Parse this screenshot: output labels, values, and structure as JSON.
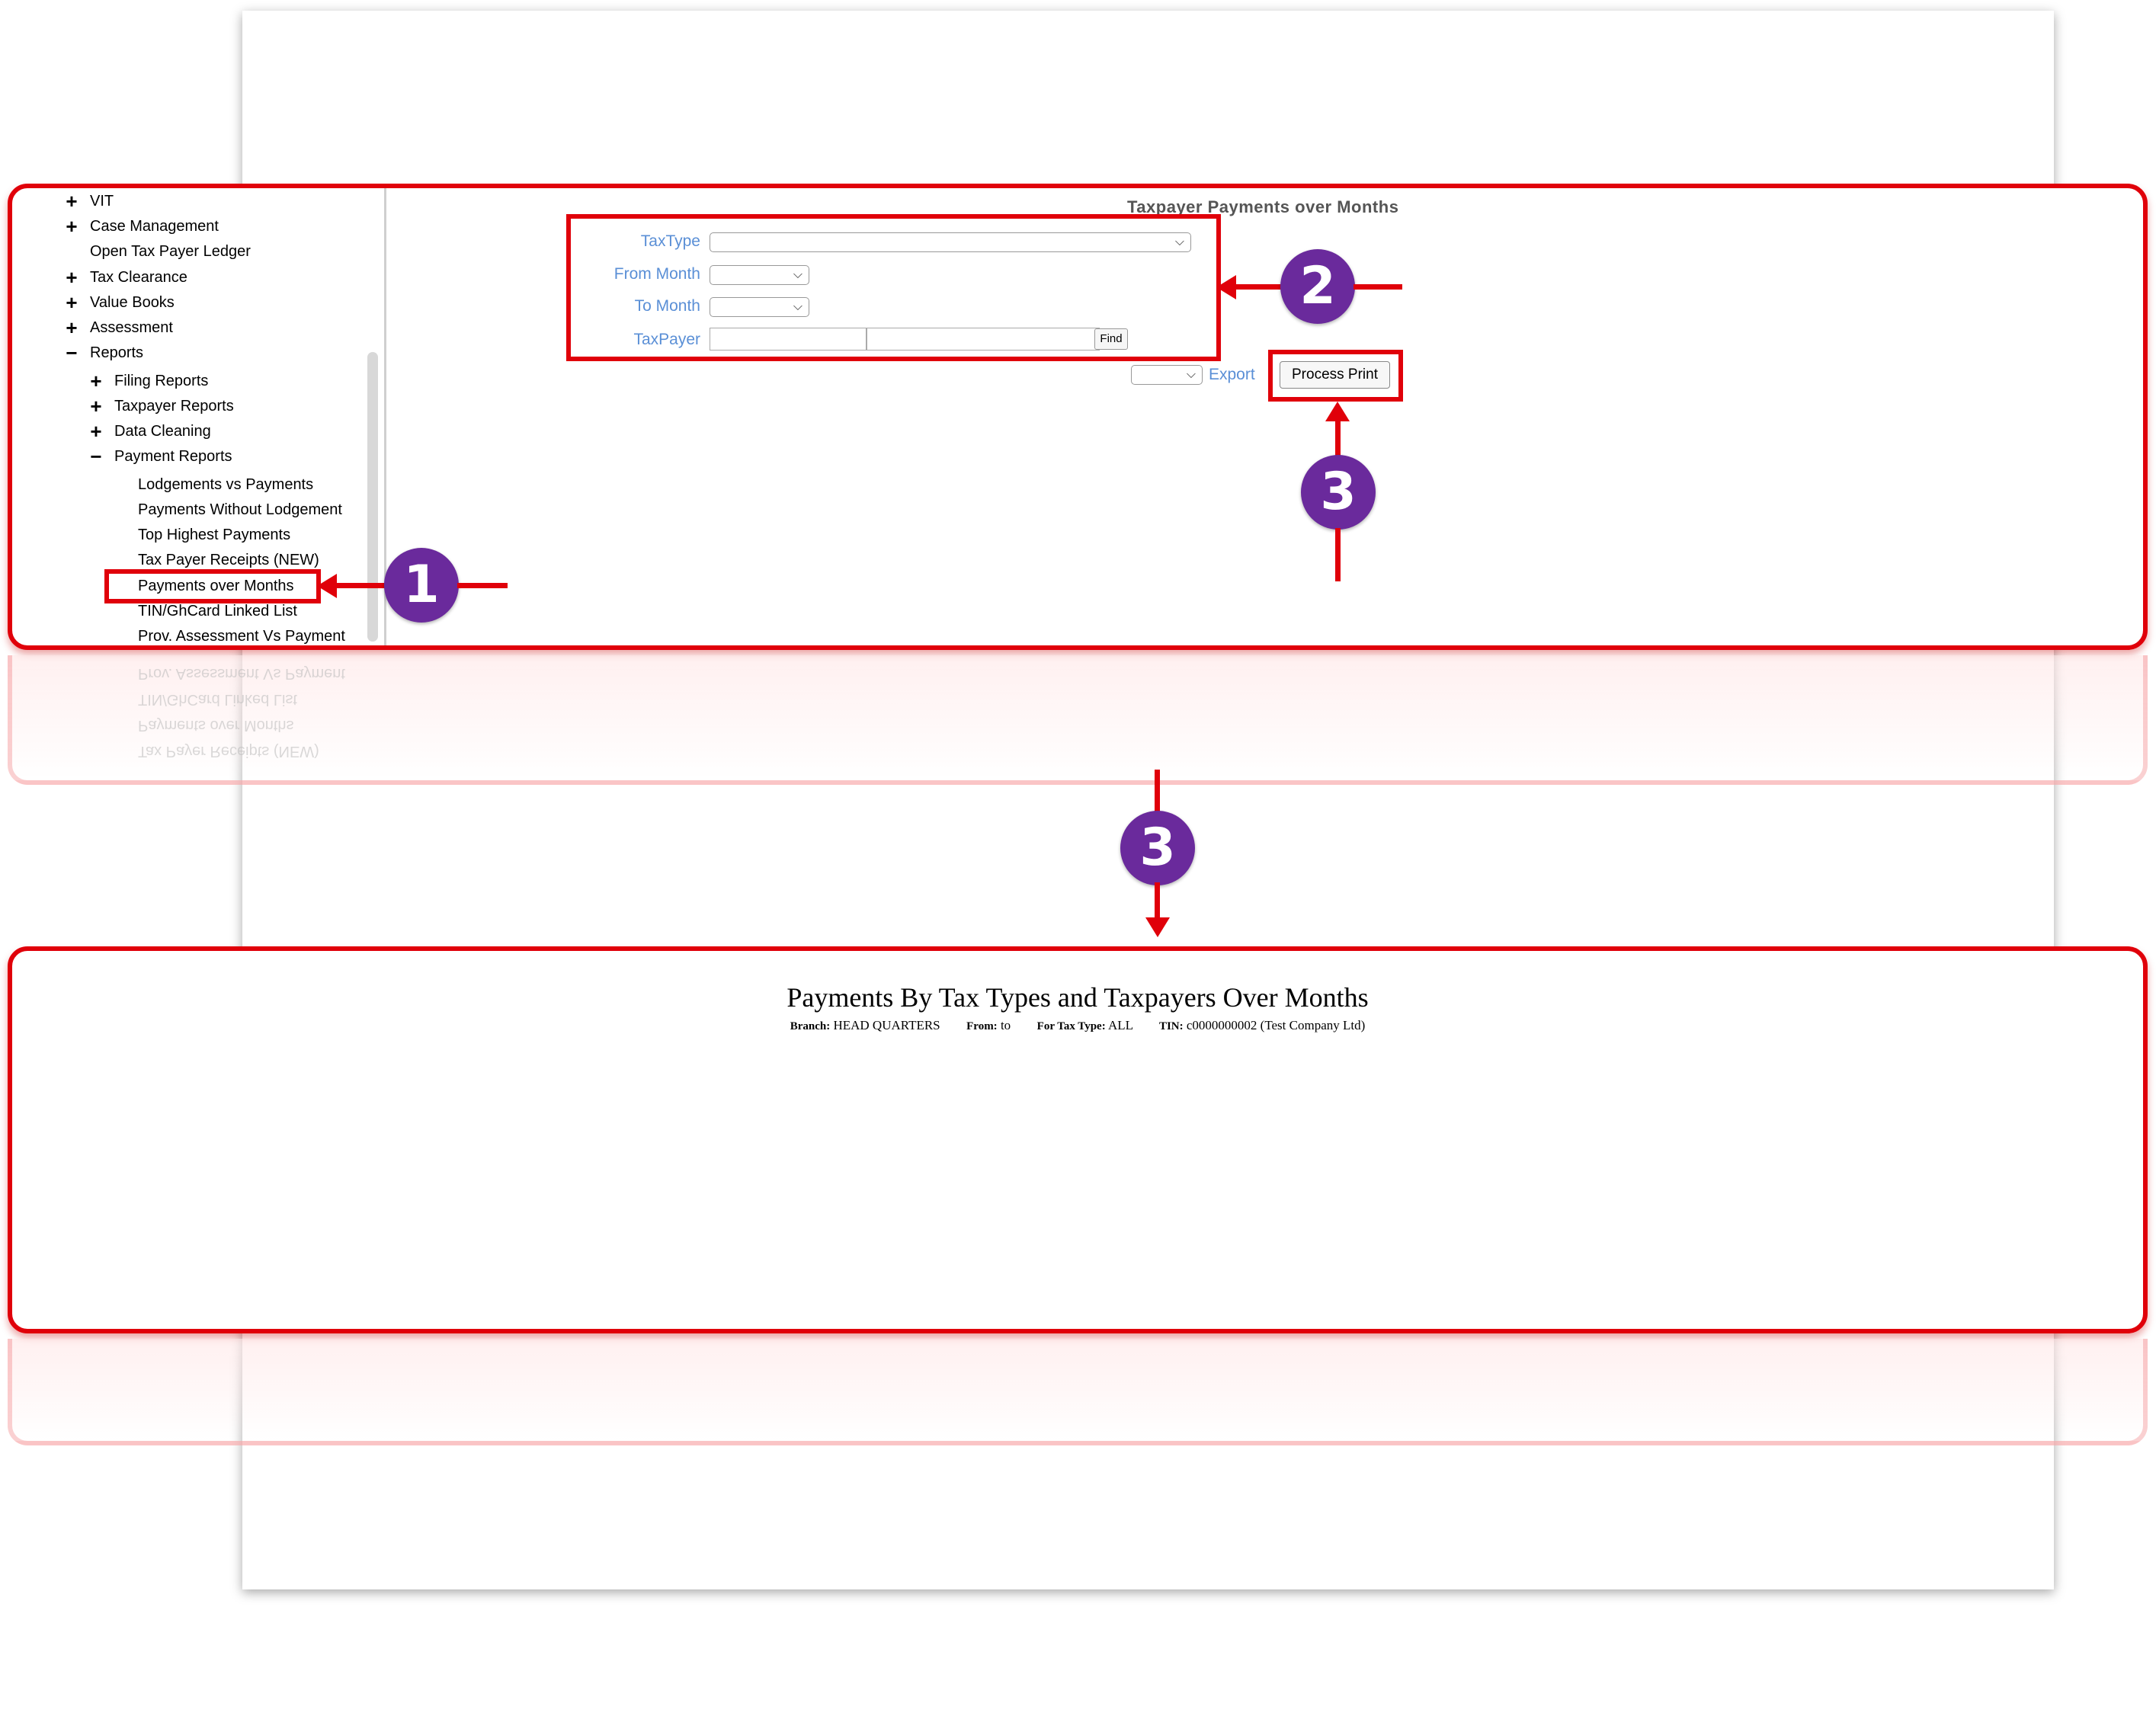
{
  "tree": {
    "items": [
      {
        "label": "VIT",
        "toggle": "+",
        "level": 0
      },
      {
        "label": "Case Management",
        "toggle": "+",
        "level": 0
      },
      {
        "label": "Open Tax Payer Ledger",
        "toggle": "",
        "level": 0
      },
      {
        "label": "Tax Clearance",
        "toggle": "+",
        "level": 0
      },
      {
        "label": "Value Books",
        "toggle": "+",
        "level": 0
      },
      {
        "label": "Assessment",
        "toggle": "+",
        "level": 0
      },
      {
        "label": "Reports",
        "toggle": "−",
        "level": 0
      },
      {
        "label": "Filing Reports",
        "toggle": "+",
        "level": 1
      },
      {
        "label": "Taxpayer Reports",
        "toggle": "+",
        "level": 1
      },
      {
        "label": "Data Cleaning",
        "toggle": "+",
        "level": 1
      },
      {
        "label": "Payment Reports",
        "toggle": "−",
        "level": 1
      },
      {
        "label": "Lodgements vs Payments",
        "toggle": "",
        "level": 2
      },
      {
        "label": "Payments Without Lodgement",
        "toggle": "",
        "level": 2
      },
      {
        "label": "Top Highest Payments",
        "toggle": "",
        "level": 2
      },
      {
        "label": "Tax Payer Receipts (NEW)",
        "toggle": "",
        "level": 2
      },
      {
        "label": "Payments over Months",
        "toggle": "",
        "level": 2
      },
      {
        "label": "TIN/GhCard Linked List",
        "toggle": "",
        "level": 2
      },
      {
        "label": "Prov. Assessment Vs Payment",
        "toggle": "",
        "level": 2
      }
    ]
  },
  "form": {
    "title": "Taxpayer Payments over Months",
    "taxtype_label": "TaxType",
    "from_month_label": "From Month",
    "to_month_label": "To Month",
    "taxpayer_label": "TaxPayer",
    "find_label": "Find",
    "export_label": "Export",
    "process_print_label": "Process Print"
  },
  "badges": {
    "one": "1",
    "two": "2",
    "three": "3"
  },
  "report": {
    "title": "Payments By Tax Types and Taxpayers Over Months",
    "branch_label": "Branch:",
    "branch_value": "HEAD QUARTERS",
    "from_label": "From:",
    "from_value": "to",
    "taxtype_label": "For Tax Type:",
    "taxtype_value": "ALL",
    "tin_label": "TIN:",
    "tin_value": "c0000000002 (Test Company Ltd)"
  }
}
